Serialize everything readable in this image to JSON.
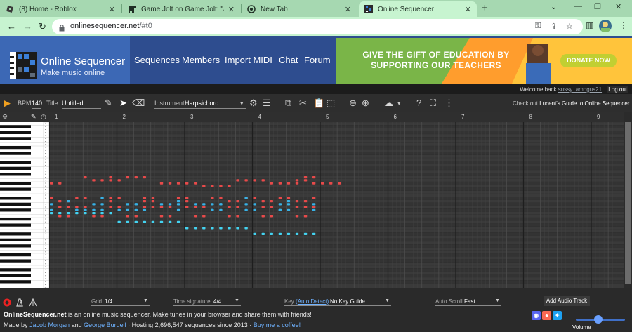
{
  "browser": {
    "tabs": [
      {
        "title": "(8) Home - Roblox",
        "icon": "roblox-icon"
      },
      {
        "title": "Game Jolt on Game Jolt: \"A new",
        "icon": "gamejolt-icon"
      },
      {
        "title": "New Tab",
        "icon": "chrome-icon"
      },
      {
        "title": "Online Sequencer",
        "icon": "sequencer-icon"
      }
    ],
    "new_tab_label": "+",
    "url_host": "onlinesequencer.net",
    "url_path": "/#t0",
    "colors": {
      "tabstrip": "#a6d8b1",
      "toolbar": "#c7f4d0"
    }
  },
  "site": {
    "title": "Online Sequencer",
    "subtitle": "Make music online",
    "nav": [
      "Sequences",
      "Members",
      "Import MIDI",
      "Chat",
      "Forum"
    ],
    "ad": {
      "line1": "GIVE THE GIFT OF EDUCATION BY",
      "line2": "SUPPORTING OUR TEACHERS",
      "button": "DONATE NOW"
    },
    "welcome_prefix": "Welcome back",
    "username": "sussy_amogus21",
    "logout": "Log out",
    "colors": {
      "header": "#2e4d8f",
      "logo_bg": "#3c68b5",
      "ad_bg": "#ffc43b",
      "ad_button": "#c1cf32"
    }
  },
  "toolbar": {
    "bpm_label": "BPM",
    "bpm_value": "140",
    "title_label": "Title",
    "title_value": "Untitled",
    "instrument_label": "Instrument",
    "instrument_value": "Harpsichord",
    "guide_prefix": "Check out",
    "guide_link": "Lucent's Guide to Online Sequencer"
  },
  "ruler": {
    "bars": [
      "1",
      "2",
      "3",
      "4",
      "5",
      "6",
      "7",
      "8",
      "9"
    ]
  },
  "notes": {
    "colors": {
      "red": "#e84a4a",
      "blue": "#38b2e6",
      "cyan": "#44d4f2"
    },
    "bass_line": [
      {
        "start": 0.0,
        "end": 1.0,
        "row": 30
      },
      {
        "start": 1.0,
        "end": 2.0,
        "row": 33
      },
      {
        "start": 2.0,
        "end": 3.0,
        "row": 35
      },
      {
        "start": 3.0,
        "end": 4.0,
        "row": 37
      }
    ]
  },
  "bottom": {
    "grid_label": "Grid",
    "grid_value": "1/4",
    "time_sig_label": "Time signature",
    "time_sig_value": "4/4",
    "key_label": "Key",
    "key_auto": "(Auto Detect)",
    "key_value": "No Key Guide",
    "autoscroll_label": "Auto Scroll",
    "autoscroll_value": "Fast",
    "add_audio": "Add Audio Track"
  },
  "footer": {
    "brand": "OnlineSequencer.net",
    "tagline": " is an online music sequencer. Make tunes in your browser and share them with friends!",
    "made_by": "Made by ",
    "author1": "Jacob Morgan",
    "and": " and ",
    "author2": "George Burdell",
    "hosting": " · Hosting 2,696,547 sequences since 2013 · ",
    "coffee": "Buy me a coffee!",
    "volume_label": "Volume",
    "volume_level": 0.45
  }
}
